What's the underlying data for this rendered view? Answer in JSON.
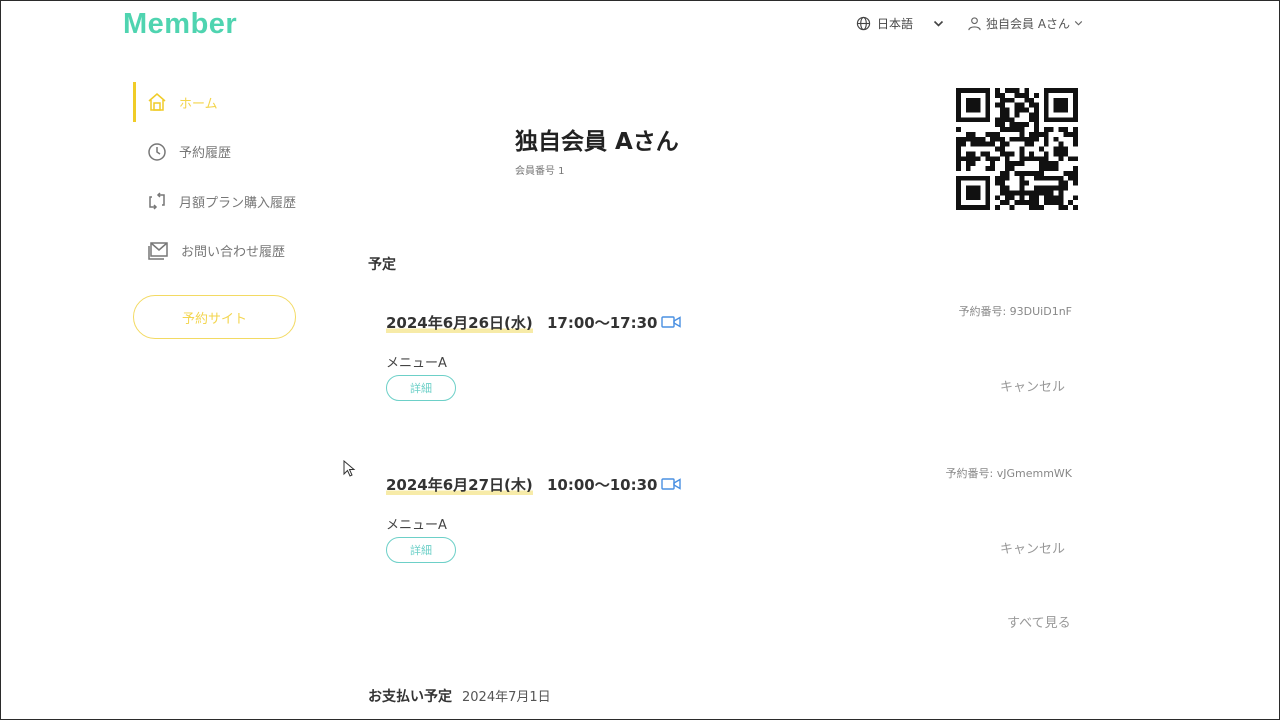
{
  "header": {
    "logo": "Member",
    "language": "日本語",
    "user": "独自会員 Aさん"
  },
  "sidebar": {
    "items": [
      {
        "label": "ホーム",
        "icon": "home-icon",
        "active": true
      },
      {
        "label": "予約履歴",
        "icon": "clock-icon"
      },
      {
        "label": "月額プラン購入履歴",
        "icon": "repeat-icon"
      },
      {
        "label": "お問い合わせ履歴",
        "icon": "mail-icon"
      }
    ],
    "reserve_site": "予約サイト"
  },
  "profile": {
    "name": "独自会員 Aさん",
    "member_no": "会員番号 1"
  },
  "schedule": {
    "title": "予定",
    "bookings": [
      {
        "date": "2024年6月26日(水)",
        "time": "17:00〜17:30",
        "ref": "予約番号: 93DUiD1nF",
        "menu": "メニューA",
        "detail": "詳細",
        "cancel": "キャンセル"
      },
      {
        "date": "2024年6月27日(木)",
        "time": "10:00〜10:30",
        "ref": "予約番号: vJGmemmWK",
        "menu": "メニューA",
        "detail": "詳細",
        "cancel": "キャンセル"
      }
    ],
    "see_all": "すべて見る"
  },
  "payment": {
    "title": "お支払い予定",
    "date": "2024年7月1日"
  },
  "colors": {
    "brand": "#4fd4b0",
    "active": "#f0cc28",
    "teal": "#6dd0c8",
    "video": "#4a90e2"
  }
}
